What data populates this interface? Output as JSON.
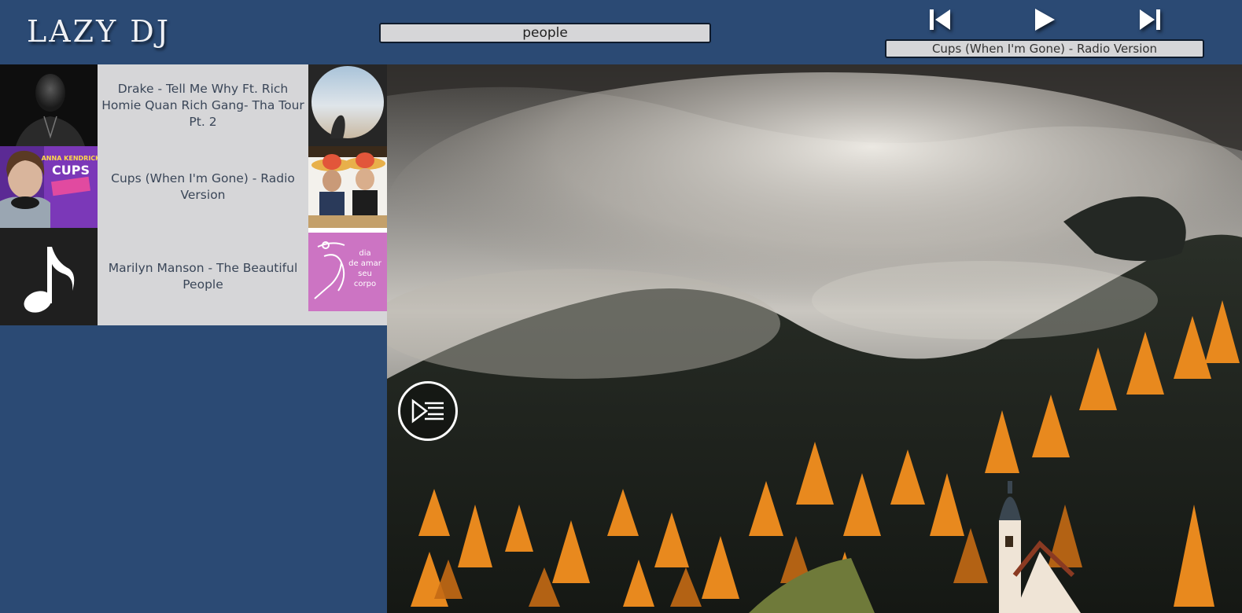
{
  "app": {
    "logo": "LAZY DJ"
  },
  "search": {
    "value": "people"
  },
  "player": {
    "now_playing": "Cups (When I'm Gone) - Radio Version",
    "controls": [
      "previous",
      "play",
      "next"
    ]
  },
  "results": [
    {
      "title": "Drake - Tell Me Why Ft. Rich Homie Quan Rich Gang- Tha Tour Pt. 2",
      "cover": "drake-portrait",
      "thumb": "person-silhouette-circle"
    },
    {
      "title": "Cups (When I'm Gone) - Radio Version",
      "cover": "anna-kendrick-cups-cover",
      "cover_text": "ANNA KENDRICK CUPS",
      "thumb": "two-people-sombreros"
    },
    {
      "title": "Marilyn Manson - The Beautiful People",
      "cover": "music-note-icon",
      "thumb": "pink-dance-logo",
      "thumb_text": [
        "dia",
        "de amar",
        "seu",
        "corpo"
      ]
    }
  ],
  "colors": {
    "background": "#2b4a74",
    "panel": "#d6d6d8",
    "text": "#3a4658",
    "accent_orange": "#e8891e"
  }
}
